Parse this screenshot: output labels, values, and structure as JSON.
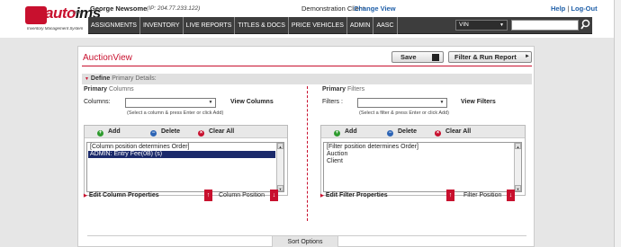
{
  "header": {
    "logo": {
      "brand_red": "auto",
      "brand_dark": "ims",
      "com": ".com",
      "tagline": "Inventory Management System"
    },
    "user_name": "George Newsome",
    "user_ip": "(IP: 204.77.233.122)",
    "client_name": "Demonstration Client",
    "change_view": "Change View",
    "help": "Help",
    "separator": "|",
    "logout": "Log-Out"
  },
  "nav": {
    "items": [
      "ASSIGNMENTS",
      "INVENTORY",
      "LIVE REPORTS",
      "TITLES & DOCS",
      "PRICE VEHICLES",
      "ADMIN",
      "AASC"
    ],
    "search_type": "VIN",
    "search_value": "",
    "search_icon": "magnifier-icon"
  },
  "page": {
    "title": "AuctionView",
    "save_label": "Save",
    "save_icon": "floppy-disk-icon",
    "filter_run_label": "Filter & Run Report",
    "define_label": "Define",
    "define_sub": "Primary Details:"
  },
  "columns": {
    "heading": "Primary",
    "heading_sub": "Columns",
    "field_label": "Columns:",
    "select_value": "",
    "view_label": "View Columns",
    "hint": "(Select a column & press Enter or click Add)",
    "add": "Add",
    "delete": "Delete",
    "clear": "Clear All",
    "items": [
      "[Column position determines Order]",
      "ADMIN: Entry Fee(0B) (s)"
    ],
    "selected_index": 1,
    "edit_label": "Edit Column Properties",
    "position_label": "Column Position"
  },
  "filters": {
    "heading": "Primary",
    "heading_sub": "Filters",
    "field_label": "Filters :",
    "select_value": "",
    "view_label": "View Filters",
    "hint": "(Select a filter & press Enter or click Add)",
    "add": "Add",
    "delete": "Delete",
    "clear": "Clear All",
    "items": [
      "[Filter position determines Order]",
      "Auction",
      "Client"
    ],
    "edit_label": "Edit Filter Properties",
    "position_label": "Filter Position"
  },
  "sort": {
    "label": "Sort Options"
  },
  "colors": {
    "brand_red": "#c8102e",
    "nav_bg": "#3d3d3d",
    "link_blue": "#1f5fa8",
    "selection": "#1b2a6b"
  }
}
